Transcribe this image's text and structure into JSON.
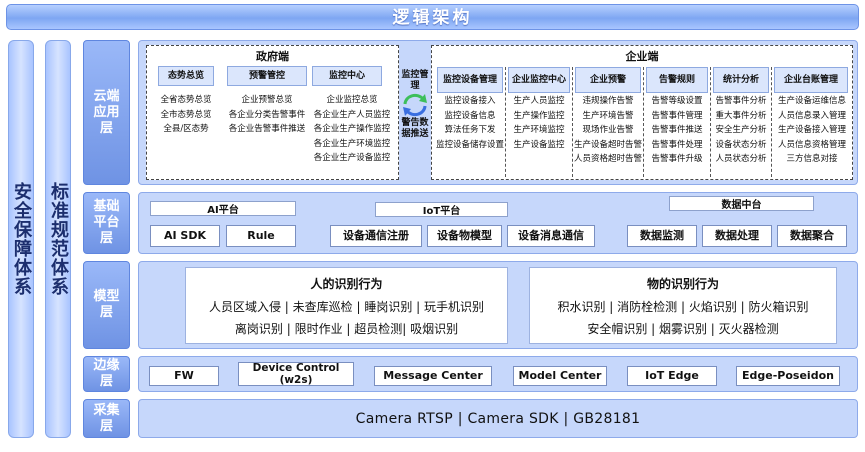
{
  "title": "逻辑架构",
  "pillars": {
    "security": "安全保障体系",
    "standards": "标准规范体系"
  },
  "layers": {
    "app": "云端应用层",
    "platform": "基础平台层",
    "model": "模型层",
    "edge": "边缘层",
    "collect": "采集层"
  },
  "app": {
    "gov": {
      "title": "政府端",
      "columns": [
        {
          "header": "态势总览",
          "items": [
            "全省态势总览",
            "全市态势总览",
            "全县/区态势"
          ]
        },
        {
          "header": "预警管控",
          "items": [
            "企业预警总览",
            "各企业分类告警事件",
            "各企业告警事件推送"
          ]
        },
        {
          "header": "监控中心",
          "items": [
            "企业监控总览",
            "各企业生产人员监控",
            "各企业生产操作监控",
            "各企业生产环境监控",
            "各企业生产设备监控"
          ]
        }
      ]
    },
    "middle": {
      "top": "监控管理",
      "bottom": "警告数据推送"
    },
    "ent": {
      "title": "企业端",
      "columns": [
        {
          "header": "监控设备管理",
          "items": [
            "监控设备接入",
            "监控设备信息",
            "算法任务下发",
            "监控设备储存设置"
          ]
        },
        {
          "header": "企业监控中心",
          "items": [
            "生产人员监控",
            "生产操作监控",
            "生产环境监控",
            "生产设备监控"
          ]
        },
        {
          "header": "企业预警",
          "items": [
            "违规操作告警",
            "生产环境告警",
            "现场作业告警",
            "生产设备超时告警",
            "人员资格超时告警"
          ]
        },
        {
          "header": "告警规则",
          "items": [
            "告警等级设置",
            "告警事件管理",
            "告警事件推送",
            "告警事件处理",
            "告警事件升级"
          ]
        },
        {
          "header": "统计分析",
          "items": [
            "告警事件分析",
            "重大事件分析",
            "安全生产分析",
            "设备状态分析",
            "人员状态分析"
          ]
        },
        {
          "header": "企业台账管理",
          "items": [
            "生产设备运维信息",
            "人员信息录入管理",
            "生产设备接入管理",
            "人员信息资格管理",
            "三方信息对接"
          ]
        }
      ]
    }
  },
  "platform": {
    "ai": {
      "title": "AI平台",
      "items": [
        "AI SDK",
        "Rule"
      ]
    },
    "iot": {
      "title": "IoT平台",
      "items": [
        "设备通信注册",
        "设备物模型",
        "设备消息通信"
      ]
    },
    "data": {
      "title": "数据中台",
      "items": [
        "数据监测",
        "数据处理",
        "数据聚合"
      ]
    }
  },
  "model": {
    "person": {
      "title": "人的识别行为",
      "line1": "人员区域入侵 | 未查库巡检 | 睡岗识别 | 玩手机识别",
      "line2": "离岗识别 | 限时作业 | 超员检测| 吸烟识别"
    },
    "object": {
      "title": "物的识别行为",
      "line1": "积水识别 | 消防栓检测 | 火焰识别 | 防火箱识别",
      "line2": "安全帽识别 | 烟雾识别 | 灭火器检测"
    }
  },
  "edge": {
    "items": [
      "FW",
      "Device Control (w2s)",
      "Message Center",
      "Model Center",
      "IoT  Edge",
      "Edge-Poseidon"
    ]
  },
  "collect": {
    "text": "Camera RTSP | Camera SDK | GB28181"
  },
  "colors": {
    "accent": "#6f93e4",
    "layer_bg": "#c6d7fb",
    "arrow_green": "#3dbf5b",
    "arrow_blue": "#3a6fe0"
  }
}
